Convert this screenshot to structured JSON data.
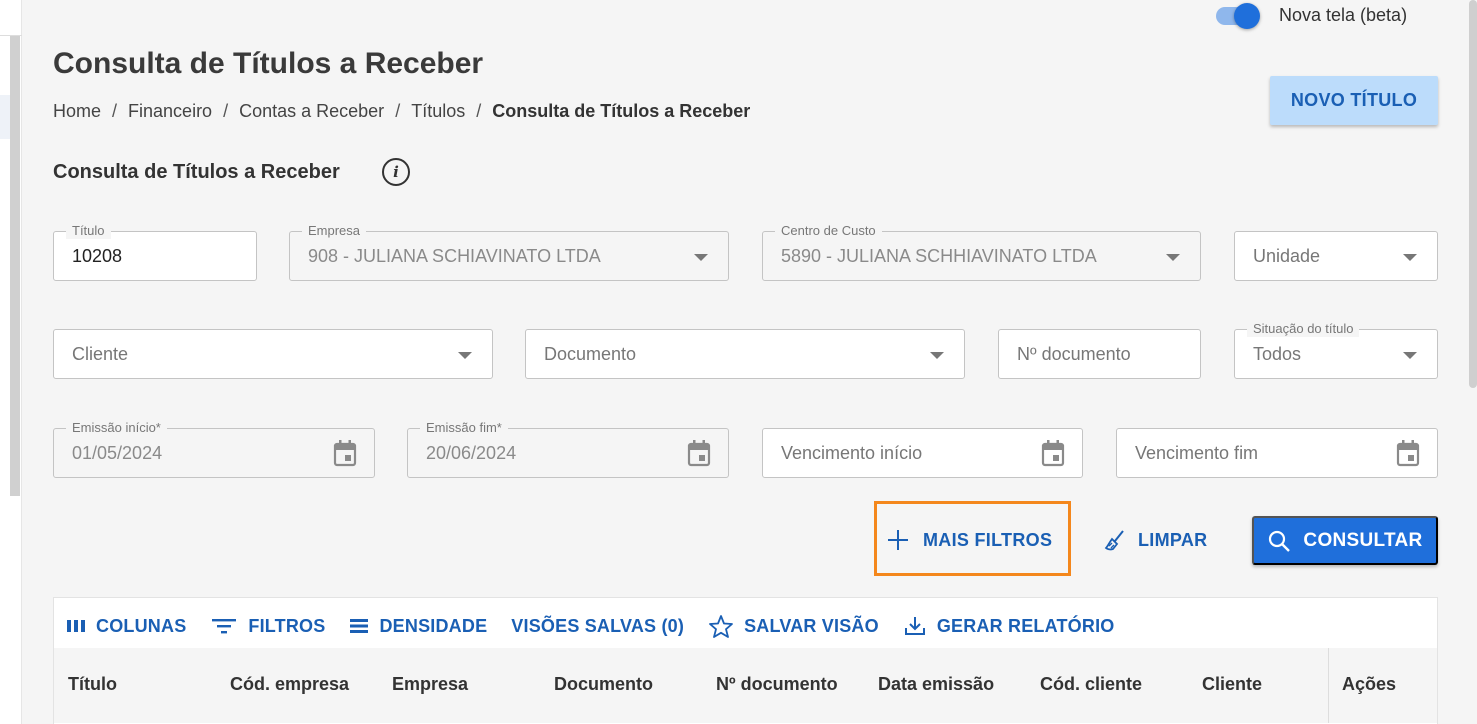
{
  "toggle": {
    "label": "Nova tela (beta)",
    "on": true
  },
  "page_title": "Consulta de Títulos a Receber",
  "breadcrumb": {
    "items": [
      "Home",
      "Financeiro",
      "Contas a Receber",
      "Títulos"
    ],
    "current": "Consulta de Títulos a Receber",
    "separator": "/"
  },
  "header": {
    "new_button": "NOVO TÍTULO"
  },
  "section": {
    "title": "Consulta de Títulos a Receber",
    "info_icon": "info-icon"
  },
  "filters": {
    "titulo": {
      "label": "Título",
      "value": "10208"
    },
    "empresa": {
      "label": "Empresa",
      "value": "908 - JULIANA SCHIAVINATO LTDA"
    },
    "centro_custo": {
      "label": "Centro de Custo",
      "value": "5890 - JULIANA SCHHIAVINATO LTDA"
    },
    "unidade": {
      "placeholder": "Unidade"
    },
    "cliente": {
      "placeholder": "Cliente"
    },
    "documento": {
      "placeholder": "Documento"
    },
    "num_documento": {
      "placeholder": "Nº documento"
    },
    "situacao": {
      "label": "Situação do título",
      "value": "Todos"
    },
    "emissao_inicio": {
      "label": "Emissão início*",
      "value": "01/05/2024"
    },
    "emissao_fim": {
      "label": "Emissão fim*",
      "value": "20/06/2024"
    },
    "vencimento_inicio": {
      "placeholder": "Vencimento início"
    },
    "vencimento_fim": {
      "placeholder": "Vencimento fim"
    }
  },
  "actions": {
    "mais_filtros": "MAIS FILTROS",
    "limpar": "LIMPAR",
    "consultar": "CONSULTAR"
  },
  "grid": {
    "toolbar": {
      "colunas": "COLUNAS",
      "filtros": "FILTROS",
      "densidade": "DENSIDADE",
      "visoes_salvas": "VISÕES SALVAS (0)",
      "salvar_visao": "SALVAR VISÃO",
      "gerar_relatorio": "GERAR RELATÓRIO"
    },
    "columns": [
      "Título",
      "Cód. empresa",
      "Empresa",
      "Documento",
      "Nº documento",
      "Data emissão",
      "Cód. cliente",
      "Cliente",
      "Ações"
    ]
  },
  "colors": {
    "primary": "#1f6fdb",
    "primary_light": "#bcdcfb",
    "highlight": "#f4871c",
    "background": "#f5f5f5"
  }
}
